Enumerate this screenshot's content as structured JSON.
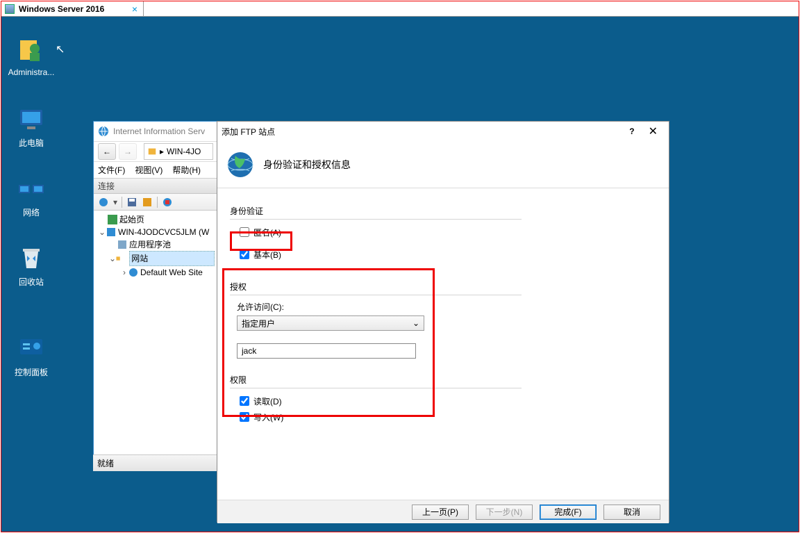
{
  "vm_tab": {
    "label": "Windows Server 2016"
  },
  "desktop": {
    "icons": {
      "administrator": "Administra...",
      "this_pc": "此电脑",
      "network": "网络",
      "recycle": "回收站",
      "cpanel": "控制面板"
    }
  },
  "iis": {
    "title": "Internet Information Serv",
    "breadcrumb_root": "WIN-4JO",
    "menus": {
      "file": "文件(F)",
      "view": "视图(V)",
      "help": "帮助(H)"
    },
    "pane_title": "连接",
    "tree": {
      "start": "起始页",
      "server": "WIN-4JODCVC5JLM (W",
      "apppools": "应用程序池",
      "sites": "网站",
      "default_site": "Default Web Site"
    },
    "status": "就绪"
  },
  "dialog": {
    "title": "添加 FTP 站点",
    "heading": "身份验证和授权信息",
    "auth": {
      "group": "身份验证",
      "anonymous": {
        "label": "匿名(A)",
        "checked": false
      },
      "basic": {
        "label": "基本(B)",
        "checked": true
      }
    },
    "authorization": {
      "group": "授权",
      "allow_label": "允许访问(C):",
      "allow_selected": "指定用户",
      "user_value": "jack"
    },
    "permissions": {
      "group": "权限",
      "read": {
        "label": "读取(D)",
        "checked": true
      },
      "write": {
        "label": "写入(W)",
        "checked": true
      }
    },
    "buttons": {
      "prev": "上一页(P)",
      "next": "下一步(N)",
      "finish": "完成(F)",
      "cancel": "取消"
    }
  }
}
